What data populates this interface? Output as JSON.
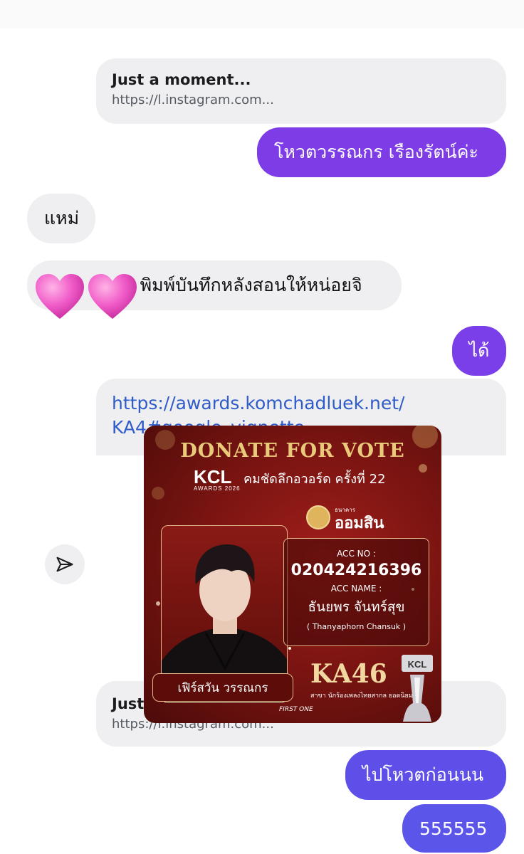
{
  "messages": {
    "preview1": {
      "title": "Just a moment...",
      "url": "https://l.instagram.com..."
    },
    "out1": "โหวตวรรณกร เรืองรัตน์ค่ะ",
    "in1": "แหม่",
    "in2": "พิมพ์บันทึกหลังสอนให้หน่อยจิ",
    "in2_hidden_prefix": "จ",
    "out2": "ได้",
    "link_line1": "https://awards.komchadluek.net/",
    "link_line2": "KA4#google_vignette",
    "preview2": {
      "title": "Just",
      "url": "https://l.instagram.com..."
    },
    "out3": "ไปโหวตก่อนนน",
    "out4": "555555"
  },
  "icons": {
    "heart": "pink-heart-icon",
    "share": "send-icon"
  },
  "colors": {
    "out_bubble": "#7b3fe0",
    "out_bubble_bottom": "#5b4fe6",
    "in_bubble": "#efeff2",
    "link": "#2f5cc8"
  },
  "poster": {
    "title": "DONATE FOR VOTE",
    "kcl": "KCL",
    "kcl_sub": "AWARDS 2026",
    "subtitle": "คมชัดลึกอวอร์ด ครั้งที่ 22",
    "bank_small": "ธนาคาร",
    "bank_name": "ออมสิน",
    "acc_no_label": "ACC NO :",
    "acc_no": "020424216396",
    "acc_name_label": "ACC NAME :",
    "acc_name_th": "ธันยพร จันทร์สุข",
    "acc_name_en": "( Thanyaphorn Chansuk )",
    "nominee": "เฟิร์สวัน วรรณกร",
    "code": "KA46",
    "category": "สาขา นักร้องเพลงไทยสากล ยอดนิยม",
    "sponsor": "FIRST ONE",
    "trophy_text": "KCL"
  }
}
